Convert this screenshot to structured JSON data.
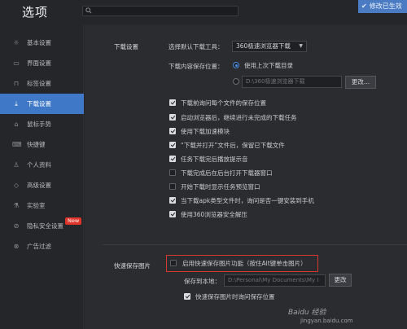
{
  "window": {
    "title": "选项"
  },
  "search": {
    "placeholder": ""
  },
  "header": {
    "save_button": "修改已生效"
  },
  "sidebar": {
    "items": [
      {
        "label": "基本设置",
        "icon": "gear-icon"
      },
      {
        "label": "界面设置",
        "icon": "monitor-icon"
      },
      {
        "label": "标签设置",
        "icon": "tab-icon"
      },
      {
        "label": "下载设置",
        "icon": "download-icon",
        "active": true
      },
      {
        "label": "鼠标手势",
        "icon": "mouse-icon"
      },
      {
        "label": "快捷键",
        "icon": "keyboard-icon"
      },
      {
        "label": "个人资料",
        "icon": "person-icon"
      },
      {
        "label": "高级设置",
        "icon": "shield-icon"
      },
      {
        "label": "实验室",
        "icon": "flask-icon"
      },
      {
        "label": "隐私安全设置",
        "icon": "privacy-icon",
        "badge": "New"
      },
      {
        "label": "广告过滤",
        "icon": "block-icon"
      }
    ]
  },
  "download": {
    "section_label": "下载设置",
    "tool_label": "选择默认下载工具：",
    "tool_value": "360极速浏览器下载",
    "location_label": "下载内容保存位置：",
    "use_last_dir": "使用上次下载目录",
    "path_value": "D:\\360极速浏览器下载",
    "change_button": "更改...",
    "options": [
      {
        "label": "下载前询问每个文件的保存位置",
        "checked": true
      },
      {
        "label": "启动浏览器后，继续进行未完成的下载任务",
        "checked": true
      },
      {
        "label": "使用下载加速模块",
        "checked": true
      },
      {
        "label": "“下载并打开”文件后，保留已下载文件",
        "checked": true
      },
      {
        "label": "任务下载完后播放提示音",
        "checked": true
      },
      {
        "label": "下载完成后在后台打开下载器窗口",
        "checked": false
      },
      {
        "label": "开始下载时显示任务预览窗口",
        "checked": false
      },
      {
        "label": "当下载apk类型文件时，询问是否一键安装到手机",
        "checked": true
      },
      {
        "label": "使用360浏览器安全解压",
        "checked": true
      }
    ]
  },
  "quicksave": {
    "section_label": "快速保存图片",
    "enable_label": "启用快速保存图片功能（按住Alt键单击图片）",
    "enable_checked": false,
    "saveto_label": "保存到本地：",
    "path_value": "D:\\Personal\\My Documents\\My I",
    "change_button": "更改",
    "ask_label": "快速保存图片时询问保存位置",
    "ask_checked": true
  },
  "watermark": {
    "line1": "Baidu 经验",
    "line2": "jingyan.baidu.com"
  },
  "colors": {
    "accent": "#3f78c7",
    "highlight": "#d23a2f",
    "badge": "#e0352b"
  }
}
